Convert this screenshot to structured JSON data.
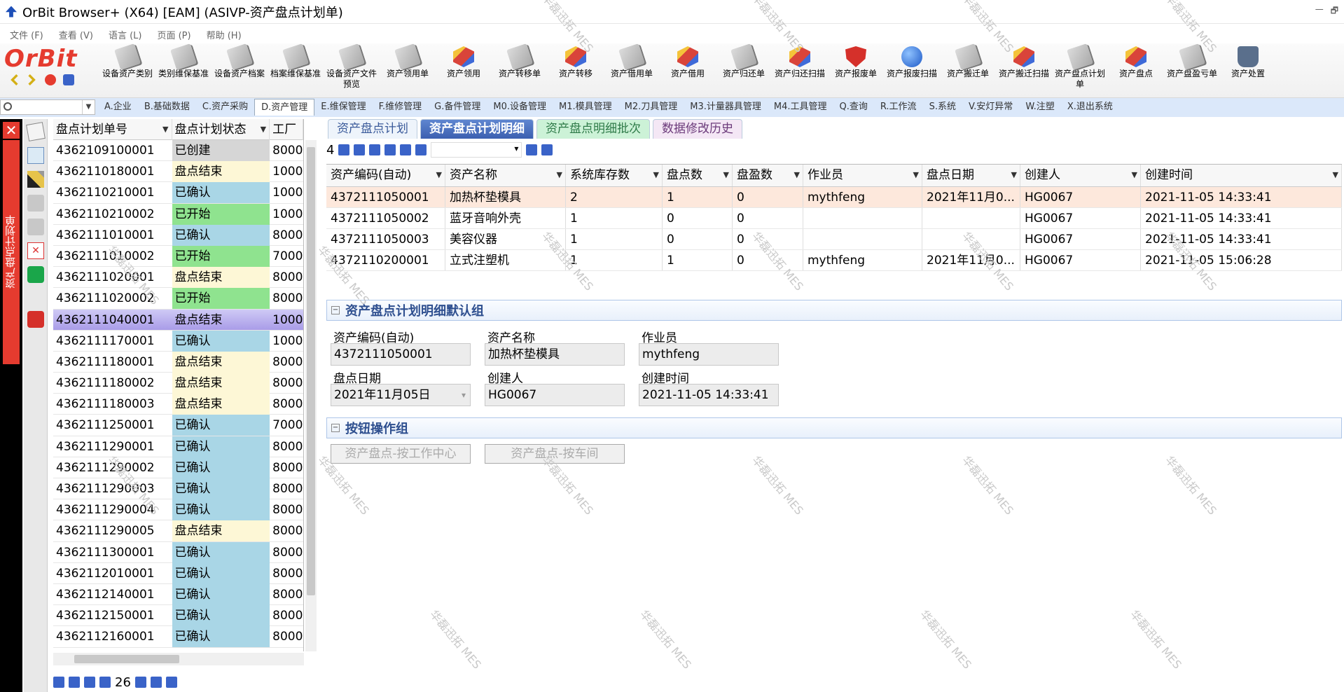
{
  "window": {
    "title": "OrBit Browser+ (X64) [EAM] (ASIVP-资产盘点计划单)",
    "ctrls": [
      "—",
      "🗗"
    ]
  },
  "menu": [
    "文件 (F)",
    "查看 (V)",
    "语言 (L)",
    "页面 (P)",
    "帮助 (H)"
  ],
  "logo": "OrBit",
  "tools": [
    {
      "label": "设备资产类别",
      "icon": "doc"
    },
    {
      "label": "类别维保基准",
      "icon": "doc"
    },
    {
      "label": "设备资产档案",
      "icon": "doc"
    },
    {
      "label": "档案维保基准",
      "icon": "doc"
    },
    {
      "label": "设备资产文件预览",
      "icon": "doc"
    },
    {
      "label": "资产领用单",
      "icon": "doc"
    },
    {
      "label": "资产领用",
      "icon": "cube"
    },
    {
      "label": "资产转移单",
      "icon": "doc"
    },
    {
      "label": "资产转移",
      "icon": "cube"
    },
    {
      "label": "资产借用单",
      "icon": "doc"
    },
    {
      "label": "资产借用",
      "icon": "cube"
    },
    {
      "label": "资产归还单",
      "icon": "doc"
    },
    {
      "label": "资产归还扫描",
      "icon": "cube"
    },
    {
      "label": "资产报废单",
      "icon": "shield"
    },
    {
      "label": "资产报废扫描",
      "icon": "globe"
    },
    {
      "label": "资产搬迁单",
      "icon": "doc"
    },
    {
      "label": "资产搬迁扫描",
      "icon": "cube"
    },
    {
      "label": "资产盘点计划单",
      "icon": "doc"
    },
    {
      "label": "资产盘点",
      "icon": "cube"
    },
    {
      "label": "资产盘盈亏单",
      "icon": "doc"
    },
    {
      "label": "资产处置",
      "icon": "hand"
    }
  ],
  "navtabs": [
    "A.企业",
    "B.基础数据",
    "C.资产采购",
    "D.资产管理",
    "E.维保管理",
    "F.维修管理",
    "G.备件管理",
    "M0.设备管理",
    "M1.模具管理",
    "M2.刀具管理",
    "M3.计量器具管理",
    "M4.工具管理",
    "Q.查询",
    "R.工作流",
    "S.系统",
    "V.安灯异常",
    "W.注塑",
    "X.退出系统"
  ],
  "active_navtab": "D.资产管理",
  "side_label": "资产盘点计划单",
  "left_table": {
    "headers": [
      "盘点计划单号",
      "盘点计划状态",
      "工厂"
    ],
    "rows": [
      [
        "4362109100001",
        "已创建",
        "8000",
        "created"
      ],
      [
        "4362110180001",
        "盘点结束",
        "1000",
        "done"
      ],
      [
        "4362110210001",
        "已确认",
        "1000",
        "confirm"
      ],
      [
        "4362110210002",
        "已开始",
        "1000",
        "started"
      ],
      [
        "4362111010001",
        "已确认",
        "8000",
        "confirm"
      ],
      [
        "4362111010002",
        "已开始",
        "7000",
        "started"
      ],
      [
        "4362111020001",
        "盘点结束",
        "8000",
        "done"
      ],
      [
        "4362111020002",
        "已开始",
        "8000",
        "started"
      ],
      [
        "4362111040001",
        "盘点结束",
        "1000",
        "selected"
      ],
      [
        "4362111170001",
        "已确认",
        "1000",
        "confirm"
      ],
      [
        "4362111180001",
        "盘点结束",
        "8000",
        "done"
      ],
      [
        "4362111180002",
        "盘点结束",
        "8000",
        "done"
      ],
      [
        "4362111180003",
        "盘点结束",
        "8000",
        "done"
      ],
      [
        "4362111250001",
        "已确认",
        "7000",
        "confirm"
      ],
      [
        "4362111290001",
        "已确认",
        "8000",
        "confirm"
      ],
      [
        "4362111290002",
        "已确认",
        "8000",
        "confirm"
      ],
      [
        "4362111290003",
        "已确认",
        "8000",
        "confirm"
      ],
      [
        "4362111290004",
        "已确认",
        "8000",
        "confirm"
      ],
      [
        "4362111290005",
        "盘点结束",
        "8000",
        "done"
      ],
      [
        "4362111300001",
        "已确认",
        "8000",
        "confirm"
      ],
      [
        "4362112010001",
        "已确认",
        "8000",
        "confirm"
      ],
      [
        "4362112140001",
        "已确认",
        "8000",
        "confirm"
      ],
      [
        "4362112150001",
        "已确认",
        "8000",
        "confirm"
      ],
      [
        "4362112160001",
        "已确认",
        "8000",
        "confirm"
      ]
    ]
  },
  "left_pager": {
    "count": "26"
  },
  "right_tabs": [
    "资产盘点计划",
    "资产盘点计划明细",
    "资产盘点明细批次",
    "数据修改历史"
  ],
  "right_count": "4",
  "detail_table": {
    "headers": [
      "资产编码(自动)",
      "资产名称",
      "系统库存数",
      "盘点数",
      "盘盈数",
      "作业员",
      "盘点日期",
      "创建人",
      "创建时间"
    ],
    "rows": [
      [
        "4372111050001",
        "加热杯垫模具",
        "2",
        "1",
        "0",
        "mythfeng",
        "2021年11月0...",
        "HG0067",
        "2021-11-05 14:33:41"
      ],
      [
        "4372111050002",
        "蓝牙音响外壳",
        "1",
        "0",
        "0",
        "",
        "",
        "HG0067",
        "2021-11-05 14:33:41"
      ],
      [
        "4372111050003",
        "美容仪器",
        "1",
        "0",
        "0",
        "",
        "",
        "HG0067",
        "2021-11-05 14:33:41"
      ],
      [
        "4372110200001",
        "立式注塑机",
        "1",
        "1",
        "0",
        "mythfeng",
        "2021年11月0...",
        "HG0067",
        "2021-11-05 15:06:28"
      ]
    ]
  },
  "group_default": {
    "title": "资产盘点计划明细默认组",
    "fields": [
      {
        "label": "资产编码(自动)",
        "value": "4372111050001"
      },
      {
        "label": "资产名称",
        "value": "加热杯垫模具"
      },
      {
        "label": "作业员",
        "value": "mythfeng"
      },
      {
        "label": "盘点日期",
        "value": "2021年11月05日"
      },
      {
        "label": "创建人",
        "value": "HG0067"
      },
      {
        "label": "创建时间",
        "value": "2021-11-05 14:33:41"
      }
    ]
  },
  "group_buttons": {
    "title": "按钮操作组",
    "buttons": [
      "资产盘点-按工作中心",
      "资产盘点-按车间"
    ]
  },
  "watermark": "华磊迅拓 MES"
}
